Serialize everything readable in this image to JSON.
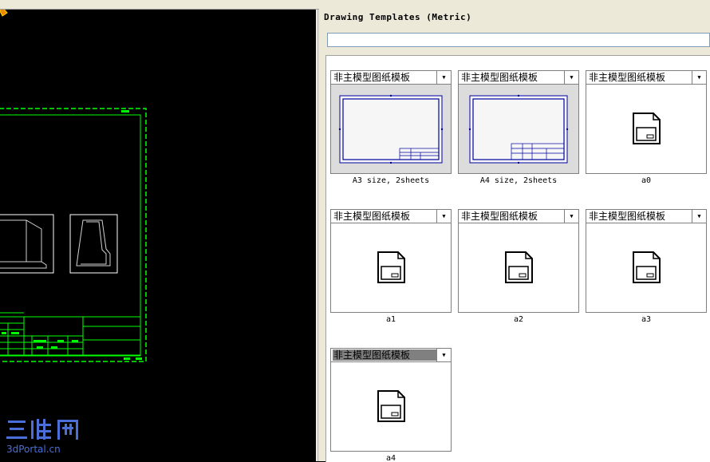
{
  "window": {
    "panel_title": "Drawing Templates (Metric)"
  },
  "search": {
    "value": ""
  },
  "templates": [
    {
      "selector": "非主模型图纸模板",
      "caption": "A3 size, 2sheets",
      "preview": "frame-a3"
    },
    {
      "selector": "非主模型图纸模板",
      "caption": "A4 size, 2sheets",
      "preview": "frame-a4"
    },
    {
      "selector": "非主模型图纸模板",
      "caption": "a0",
      "preview": "document-icon"
    },
    {
      "selector": "非主模型图纸模板",
      "caption": "a1",
      "preview": "document-icon"
    },
    {
      "selector": "非主模型图纸模板",
      "caption": "a2",
      "preview": "document-icon"
    },
    {
      "selector": "非主模型图纸模板",
      "caption": "a3",
      "preview": "document-icon"
    },
    {
      "selector": "非主模型图纸模板",
      "caption": "a4",
      "preview": "document-icon",
      "selected": true
    }
  ],
  "watermark": {
    "logo_text": "三维网",
    "site": "3dPortal.cn"
  },
  "colors": {
    "cad_background": "#000000",
    "cad_border": "#00ff00",
    "frame_blue": "#0000a0",
    "panel_bg": "#ece9d8",
    "watermark": "#4a6fd8"
  }
}
